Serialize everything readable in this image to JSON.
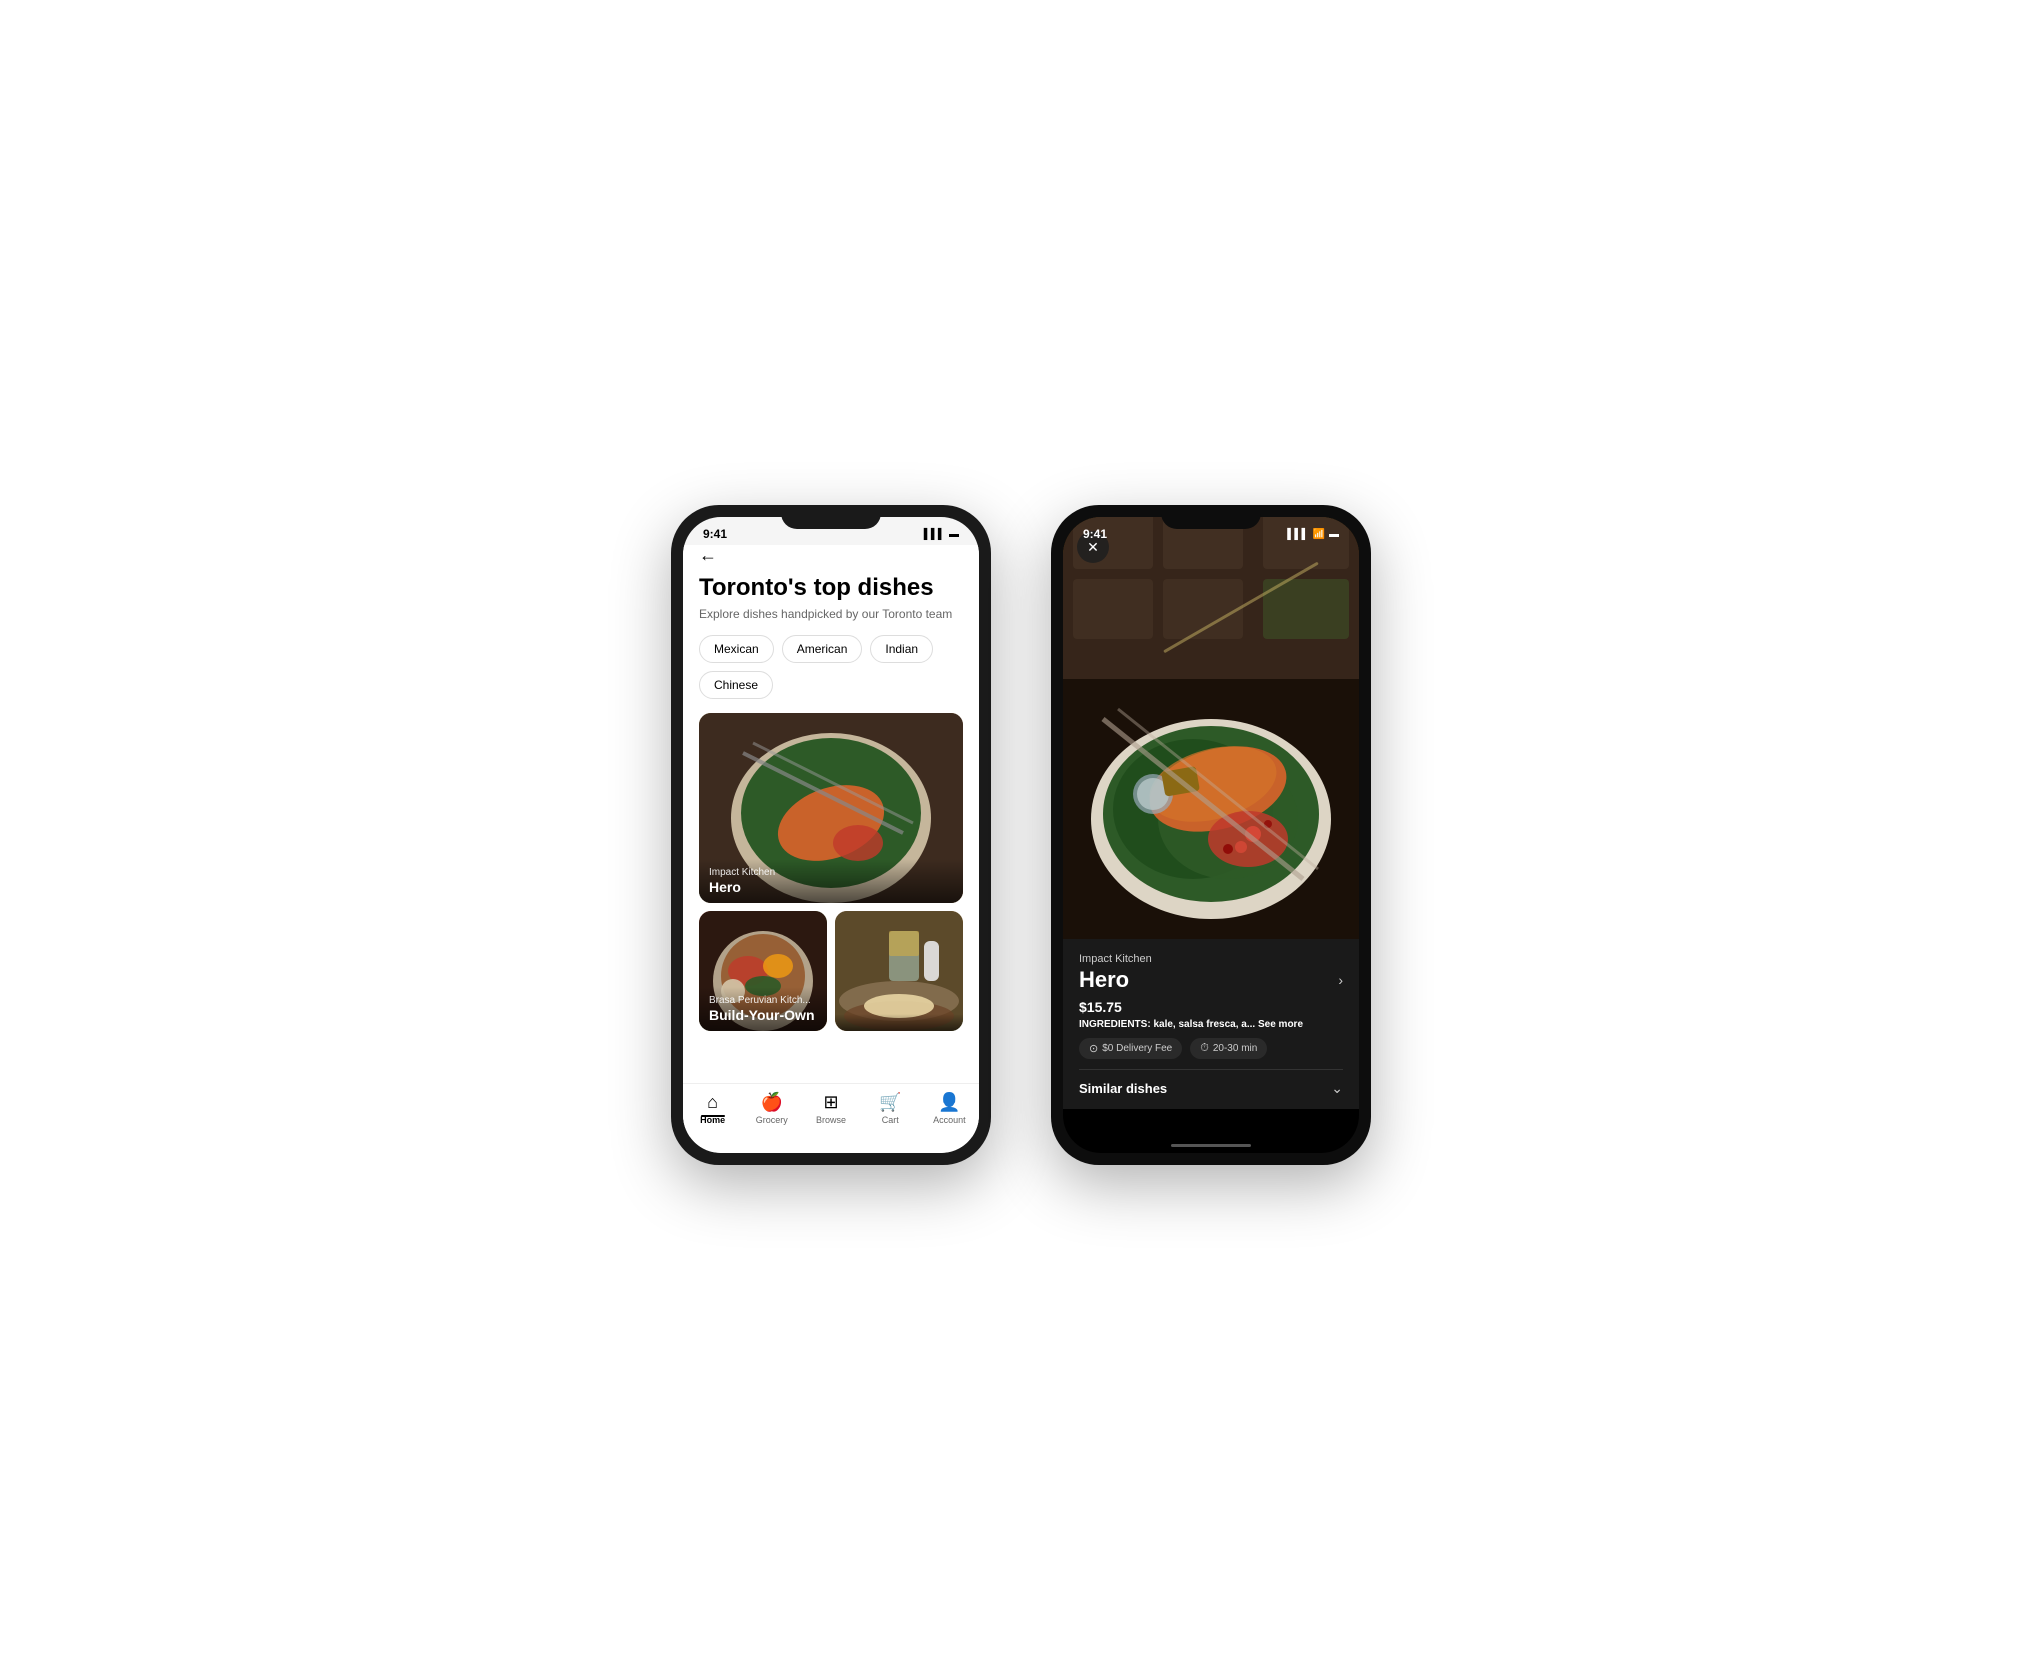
{
  "phone1": {
    "status": {
      "time": "9:41",
      "icons": "▌▌▌ 🔋"
    },
    "header": {
      "back_label": "←",
      "title": "Toronto's top dishes",
      "subtitle": "Explore dishes handpicked by our Toronto team"
    },
    "filters": [
      {
        "label": "Mexican"
      },
      {
        "label": "American"
      },
      {
        "label": "Indian"
      },
      {
        "label": "Chinese"
      }
    ],
    "cards": {
      "large": {
        "restaurant": "Impact Kitchen",
        "dish": "Hero"
      },
      "small1": {
        "restaurant": "Brasa Peruvian Kitch...",
        "dish": "Build-Your-Own"
      },
      "small2": {
        "restaurant": "",
        "dish": ""
      }
    },
    "nav": [
      {
        "icon": "🏠",
        "label": "Home",
        "active": true
      },
      {
        "icon": "🍎",
        "label": "Grocery",
        "active": false
      },
      {
        "icon": "🔍",
        "label": "Browse",
        "active": false
      },
      {
        "icon": "🛒",
        "label": "Cart",
        "active": false
      },
      {
        "icon": "👤",
        "label": "Account",
        "active": false
      }
    ]
  },
  "phone2": {
    "status": {
      "time": "9:41",
      "icons": "▌▌▌ 📶 🔋"
    },
    "detail": {
      "close_label": "✕",
      "restaurant": "Impact Kitchen",
      "dish_name": "Hero",
      "price": "$15.75",
      "ingredients_label": "INGREDIENTS:",
      "ingredients_text": "kale, salsa fresca, a...",
      "see_more": "See more",
      "delivery_fee": "$0 Delivery Fee",
      "time": "20-30 min",
      "similar_dishes": "Similar dishes"
    }
  }
}
